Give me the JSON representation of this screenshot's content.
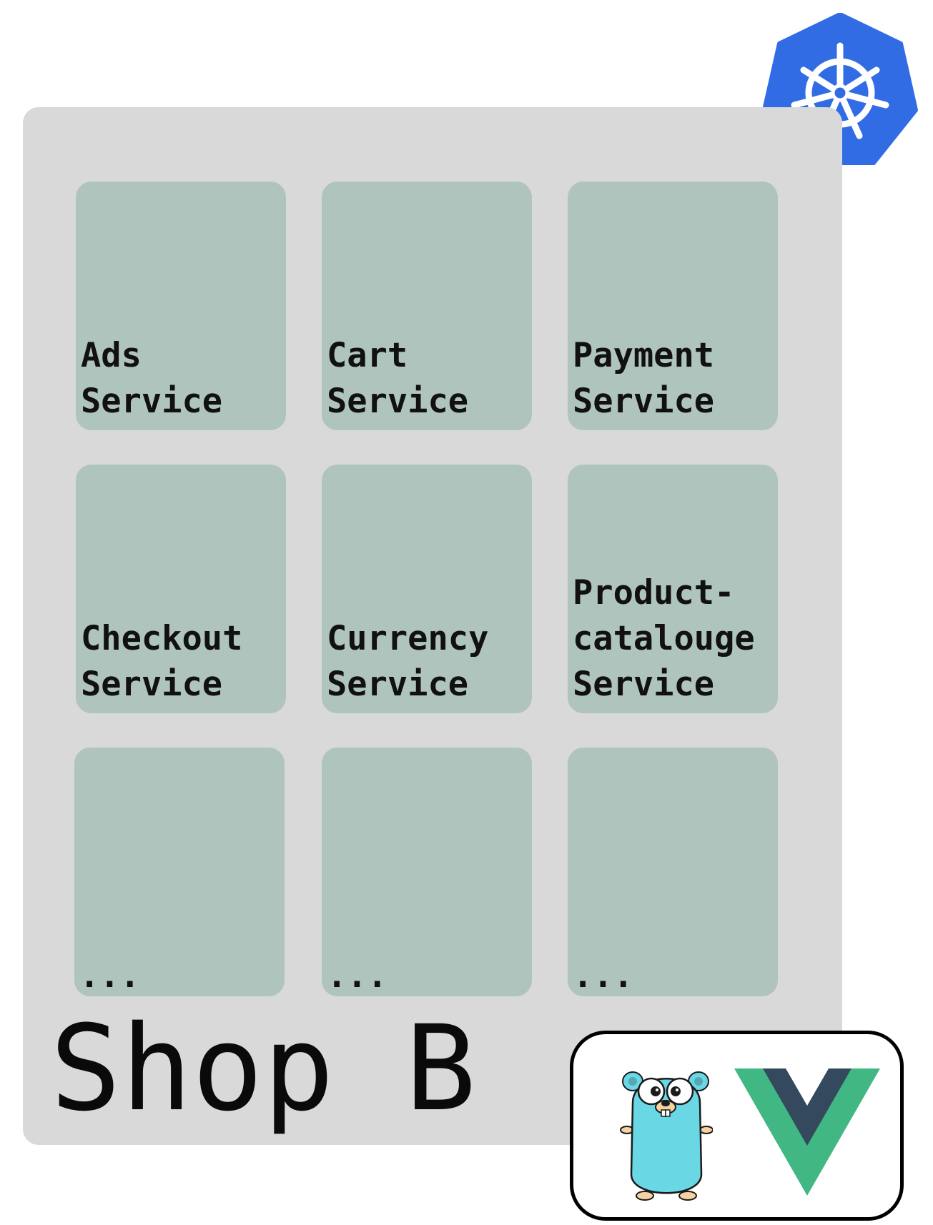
{
  "diagram": {
    "title": "Shop B",
    "services": [
      {
        "label": "Ads\nService"
      },
      {
        "label": "Cart\nService"
      },
      {
        "label": "Payment\nService"
      },
      {
        "label": "Checkout\nService"
      },
      {
        "label": "Currency\nService"
      },
      {
        "label": "Product-\ncatalouge\nService"
      },
      {
        "label": "..."
      },
      {
        "label": "..."
      },
      {
        "label": "..."
      }
    ],
    "logos": {
      "orchestrator": "kubernetes-helm-icon",
      "backend": "go-gopher-icon",
      "frontend": "vue-icon"
    },
    "colors": {
      "cluster_bg": "#d9d9d9",
      "service_bg": "#b0c4be",
      "kubernetes_blue": "#326ce5",
      "gopher_cyan": "#6ad7e5",
      "vue_green": "#41b883",
      "vue_navy": "#34495e"
    }
  }
}
